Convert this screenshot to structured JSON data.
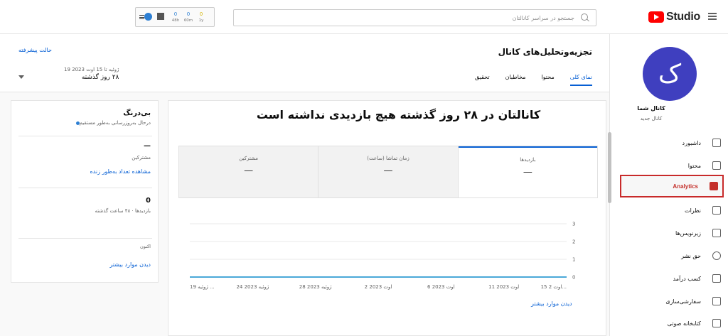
{
  "topbar": {
    "studio_label": "Studio",
    "search_placeholder": "جستجو در سراسر کانالتان",
    "widget": {
      "stats": [
        {
          "value": "0",
          "label": "48h",
          "color": "#2d7fd3"
        },
        {
          "value": "0",
          "label": "60m",
          "color": "#2d7fd3"
        },
        {
          "value": "0",
          "label": "1y",
          "color": "#d4b400"
        }
      ]
    }
  },
  "sidebar": {
    "avatar_letter": "ک",
    "channel_name": "کانال شما",
    "channel_sub": "کانال جدید",
    "items": [
      {
        "label": "داشبورد",
        "icon": "dashboard-icon"
      },
      {
        "label": "محتوا",
        "icon": "content-icon"
      },
      {
        "label": "Analytics",
        "icon": "analytics-icon"
      },
      {
        "label": "نظرات",
        "icon": "comments-icon"
      },
      {
        "label": "زیرنویس‌ها",
        "icon": "subtitles-icon"
      },
      {
        "label": "حق نشر",
        "icon": "copyright-icon"
      },
      {
        "label": "کسب درآمد",
        "icon": "monetization-icon"
      },
      {
        "label": "سفارشی‌سازی",
        "icon": "customization-icon"
      },
      {
        "label": "کتابخانه صوتی",
        "icon": "audio-library-icon"
      }
    ]
  },
  "header": {
    "title": "تجزیه‌وتحلیل‌های کانال",
    "advanced_mode": "حالت پیشرفته",
    "date_range": "19 ژوئیه تا 15 اوت 2023",
    "period": "۲۸ روز گذشته",
    "tabs": [
      "نمای کلی",
      "محتوا",
      "مخاطبان",
      "تحقیق"
    ]
  },
  "main": {
    "headline": "کانالتان در ۲۸ روز گذشته هیچ بازدیدی نداشته است",
    "metrics": [
      {
        "label": "بازدیدها",
        "value": "—"
      },
      {
        "label": "زمان تماشا (ساعت)",
        "value": "—"
      },
      {
        "label": "مشترکین",
        "value": "—"
      }
    ],
    "see_more": "دیدن موارد بیشتر"
  },
  "chart_data": {
    "type": "line",
    "x": [
      "15 اوت 2...",
      "11 اوت 2023",
      "6 اوت 2023",
      "2 اوت 2023",
      "28 ژوئیه 2023",
      "24 ژوئیه 2023",
      "19 ژوئیه ..."
    ],
    "series": [
      {
        "values": [
          0,
          0,
          0,
          0,
          0,
          0,
          0
        ]
      }
    ],
    "y_ticks": [
      "0",
      "1",
      "2",
      "3"
    ],
    "ylim": [
      0,
      3
    ],
    "grid": true,
    "line_color": "#4aa8d8"
  },
  "realtime": {
    "title": "بی‌درنگ",
    "status": "درحال به‌روزرسانی به‌طور مستقیم",
    "subscribers_value": "—",
    "subscribers_label": "مشترکین",
    "live_link": "مشاهده تعداد به‌طور زنده",
    "views_value": "0",
    "views_label": "بازدیدها · ۴۸ ساعت گذشته",
    "now_label": "اکنون",
    "see_more": "دیدن موارد بیشتر"
  }
}
